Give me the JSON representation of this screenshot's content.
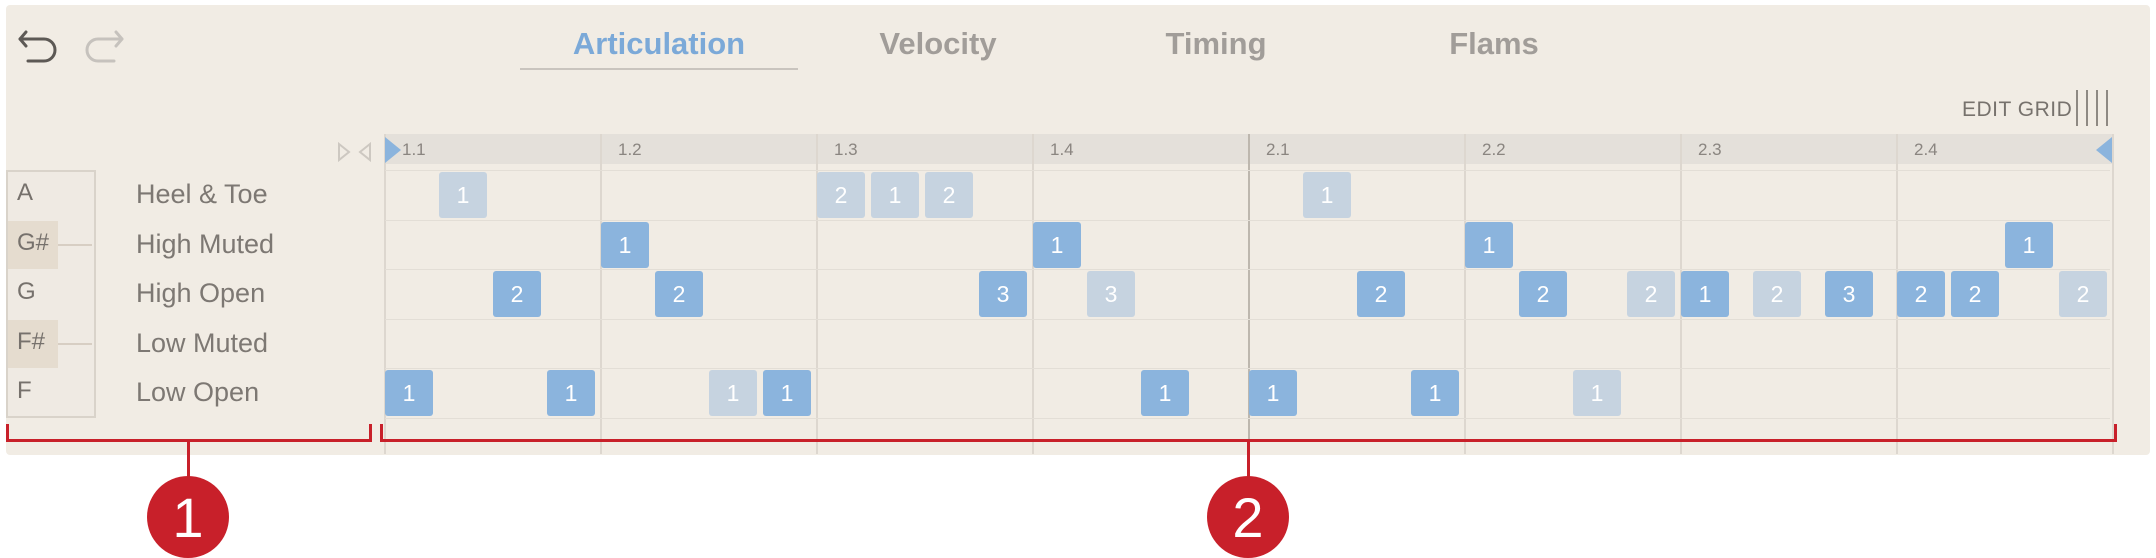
{
  "tabs": [
    {
      "label": "Articulation",
      "active": true
    },
    {
      "label": "Velocity",
      "active": false
    },
    {
      "label": "Timing",
      "active": false
    },
    {
      "label": "Flams",
      "active": false
    }
  ],
  "edit_grid_label": "EDIT GRID",
  "bar_labels": [
    "1.1",
    "1.2",
    "1.3",
    "1.4",
    "2.1",
    "2.2",
    "2.3",
    "2.4"
  ],
  "keys": [
    {
      "label": "A",
      "sharp": false
    },
    {
      "label": "G#",
      "sharp": true
    },
    {
      "label": "G",
      "sharp": false
    },
    {
      "label": "F#",
      "sharp": true
    },
    {
      "label": "F",
      "sharp": false
    }
  ],
  "rows": [
    "Heel & Toe",
    "High Muted",
    "High Open",
    "Low Muted",
    "Low Open"
  ],
  "notes": [
    {
      "row": 0,
      "step": 1,
      "value": "1",
      "dim": true
    },
    {
      "row": 0,
      "step": 8,
      "value": "2",
      "dim": true
    },
    {
      "row": 0,
      "step": 9,
      "value": "1",
      "dim": true
    },
    {
      "row": 0,
      "step": 10,
      "value": "2",
      "dim": true
    },
    {
      "row": 0,
      "step": 17,
      "value": "1",
      "dim": true
    },
    {
      "row": 1,
      "step": 4,
      "value": "1",
      "dim": false
    },
    {
      "row": 1,
      "step": 12,
      "value": "1",
      "dim": false
    },
    {
      "row": 1,
      "step": 20,
      "value": "1",
      "dim": false
    },
    {
      "row": 1,
      "step": 30,
      "value": "1",
      "dim": false
    },
    {
      "row": 2,
      "step": 2,
      "value": "2",
      "dim": false
    },
    {
      "row": 2,
      "step": 5,
      "value": "2",
      "dim": false
    },
    {
      "row": 2,
      "step": 11,
      "value": "3",
      "dim": false
    },
    {
      "row": 2,
      "step": 13,
      "value": "3",
      "dim": true
    },
    {
      "row": 2,
      "step": 18,
      "value": "2",
      "dim": false
    },
    {
      "row": 2,
      "step": 21,
      "value": "2",
      "dim": false
    },
    {
      "row": 2,
      "step": 23,
      "value": "2",
      "dim": true
    },
    {
      "row": 2,
      "step": 24,
      "value": "1",
      "dim": false
    },
    {
      "row": 2,
      "step": 25.33,
      "value": "2",
      "dim": true
    },
    {
      "row": 2,
      "step": 26.67,
      "value": "3",
      "dim": false
    },
    {
      "row": 2,
      "step": 28,
      "value": "2",
      "dim": false
    },
    {
      "row": 2,
      "step": 29,
      "value": "2",
      "dim": false
    },
    {
      "row": 2,
      "step": 31,
      "value": "2",
      "dim": true
    },
    {
      "row": 4,
      "step": 0,
      "value": "1",
      "dim": false
    },
    {
      "row": 4,
      "step": 3,
      "value": "1",
      "dim": false
    },
    {
      "row": 4,
      "step": 6,
      "value": "1",
      "dim": true
    },
    {
      "row": 4,
      "step": 7,
      "value": "1",
      "dim": false
    },
    {
      "row": 4,
      "step": 14,
      "value": "1",
      "dim": false
    },
    {
      "row": 4,
      "step": 16,
      "value": "1",
      "dim": false
    },
    {
      "row": 4,
      "step": 19,
      "value": "1",
      "dim": false
    },
    {
      "row": 4,
      "step": 22,
      "value": "1",
      "dim": true
    }
  ],
  "callouts": [
    "1",
    "2"
  ],
  "colors": {
    "note": "#8bb4dd",
    "note_dim": "#c6d3e0",
    "accent": "#7ba9d8",
    "callout": "#c8202a"
  }
}
